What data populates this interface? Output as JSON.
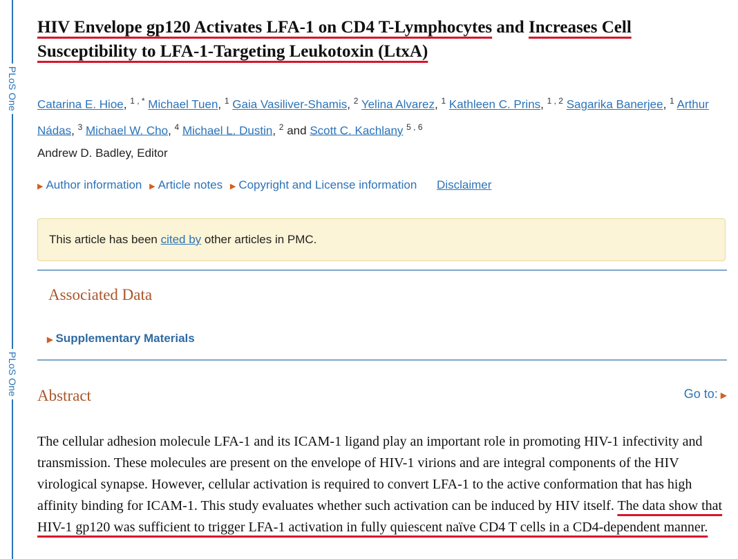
{
  "sidebar": {
    "label_top": "PLoS One",
    "label_bottom": "PLoS One"
  },
  "article": {
    "title_part1": "HIV Envelope gp120 Activates LFA-1 on CD4 T-Lymphocytes",
    "title_part2": " and ",
    "title_part3": "Increases Cell",
    "title_part4": "Susceptibility to LFA-1-Targeting Leukotoxin (LtxA)"
  },
  "authors": [
    {
      "name": "Catarina E. Hioe",
      "sup": "1 , *"
    },
    {
      "name": "Michael Tuen",
      "sup": "1"
    },
    {
      "name": "Gaia Vasiliver-Shamis",
      "sup": "2"
    },
    {
      "name": "Yelina Alvarez",
      "sup": "1"
    },
    {
      "name": "Kathleen C. Prins",
      "sup": "1 , 2"
    },
    {
      "name": "Sagarika Banerjee",
      "sup": "1"
    },
    {
      "name": "Arthur Nádas",
      "sup": "3"
    },
    {
      "name": "Michael W. Cho",
      "sup": "4"
    },
    {
      "name": "Michael L. Dustin",
      "sup": "2"
    },
    {
      "name": "Scott C. Kachlany",
      "sup": "5 , 6"
    }
  ],
  "authors_and": "and",
  "editor": "Andrew D. Badley, Editor",
  "links": {
    "author_info": "Author information",
    "article_notes": "Article notes",
    "copyright": "Copyright and License information",
    "disclaimer": "Disclaimer"
  },
  "notice": {
    "prefix": "This article has been ",
    "link": "cited by",
    "suffix": " other articles in PMC."
  },
  "associated_data": {
    "heading": "Associated Data",
    "supplementary": "Supplementary Materials"
  },
  "abstract": {
    "heading": "Abstract",
    "goto": "Go to:",
    "text_plain": "The cellular adhesion molecule LFA-1 and its ICAM-1 ligand play an important role in promoting HIV-1 infectivity and transmission. These molecules are present on the envelope of HIV-1 virions and are integral components of the HIV virological synapse. However, cellular activation is required to convert LFA-1 to the active conformation that has high affinity binding for ICAM-1. This study evaluates whether such activation can be induced by HIV itself. ",
    "text_underlined": "The data show that HIV-1 gp120 was sufficient to trigger LFA-1 activation in fully quiescent naïve CD4 T cells in a CD4-dependent manner."
  },
  "colors": {
    "link": "#2b73b8",
    "heading": "#a9562a",
    "underline": "#d9142a",
    "notice_bg": "#fbf4d6"
  }
}
